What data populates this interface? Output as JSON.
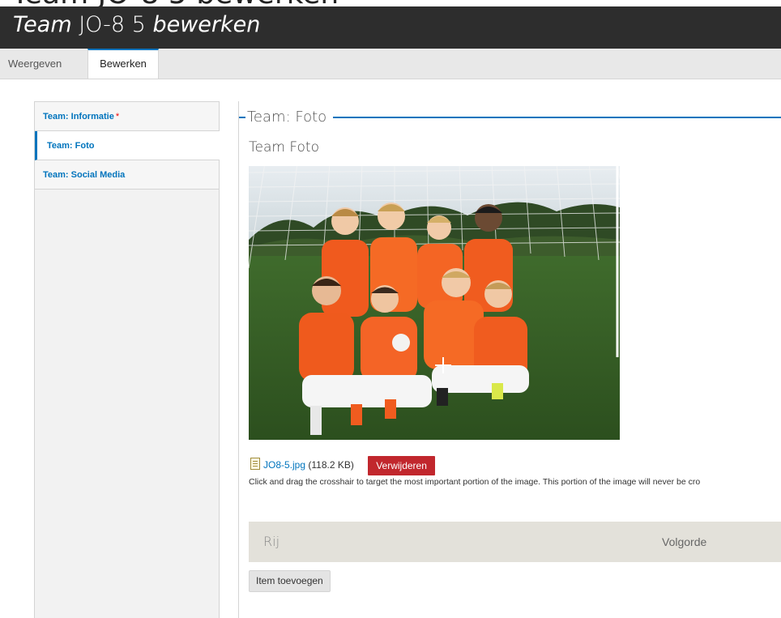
{
  "page": {
    "title_plain": "Team",
    "title_mid": " JO-8 5 ",
    "title_italic": "bewerken"
  },
  "tabs": [
    {
      "label": "Weergeven"
    },
    {
      "label": "Bewerken"
    }
  ],
  "vertical_tabs": [
    {
      "label": "Team: Informatie",
      "required": "*"
    },
    {
      "label": "Team: Foto"
    },
    {
      "label": "Team: Social Media"
    }
  ],
  "panel": {
    "legend": "Team: Foto",
    "field_label": "Team Foto",
    "file_name": "JO8-5.jpg",
    "file_size": "(118.2 KB)",
    "delete_label": "Verwijderen",
    "hint": "Click and drag the crosshair to target the most important portion of the image. This portion of the image will never be cro",
    "table": {
      "col_row": "Rij",
      "col_order": "Volgorde"
    },
    "add_label": "Item toevoegen"
  },
  "colors": {
    "accent": "#0074bd",
    "danger": "#c1272d",
    "titlebar": "#2d2d2d"
  }
}
